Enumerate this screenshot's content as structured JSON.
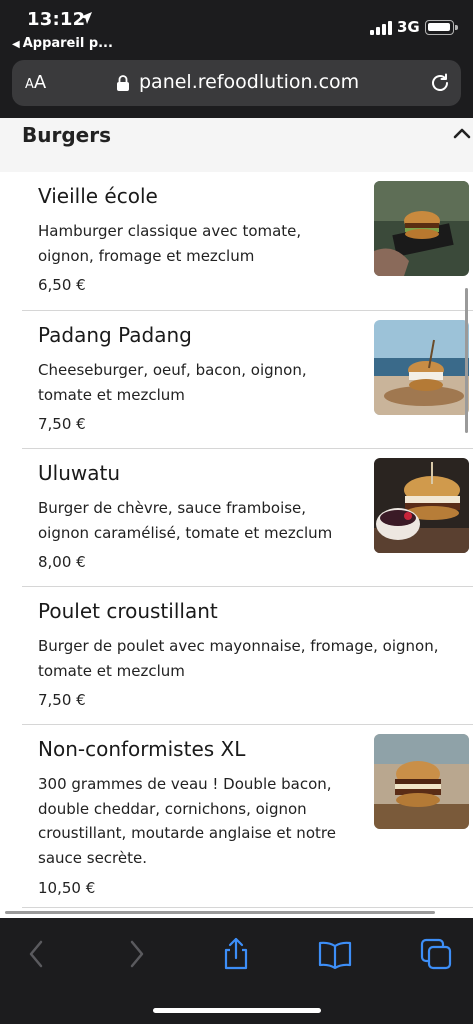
{
  "status_bar": {
    "time": "13:12",
    "back_app": "Appareil p...",
    "network": "3G"
  },
  "browser": {
    "text_size_label": "AA",
    "url": "panel.refoodlution.com"
  },
  "category": {
    "title": "Burgers"
  },
  "items": [
    {
      "name": "Vieille école",
      "description": "Hamburger classique avec tomate, oignon, fromage et mezclum",
      "price": "6,50 €"
    },
    {
      "name": "Padang Padang",
      "description": "Cheeseburger, oeuf, bacon, oignon, tomate et mezclum",
      "price": "7,50 €"
    },
    {
      "name": "Uluwatu",
      "description": "Burger de chèvre, sauce framboise, oignon caramélisé, tomate et mezclum",
      "price": "8,00 €"
    },
    {
      "name": "Poulet croustillant",
      "description": "Burger de poulet avec mayonnaise, fromage, oignon, tomate et mezclum",
      "price": "7,50 €"
    },
    {
      "name": "Non-conformistes XL",
      "description": "300 grammes de veau ! Double bacon, double cheddar, cornichons, oignon croustillant, moutarde anglaise et notre sauce secrète.",
      "price": "10,50 €"
    }
  ],
  "colors": {
    "chrome": "#1c1c1e",
    "urlbar": "#3a3a3c",
    "toolbar_active": "#3d8ef7",
    "toolbar_disabled": "#5a5a5e"
  },
  "toolbar": {
    "icons": [
      "back-icon",
      "forward-icon",
      "share-icon",
      "bookmarks-icon",
      "tabs-icon"
    ]
  }
}
